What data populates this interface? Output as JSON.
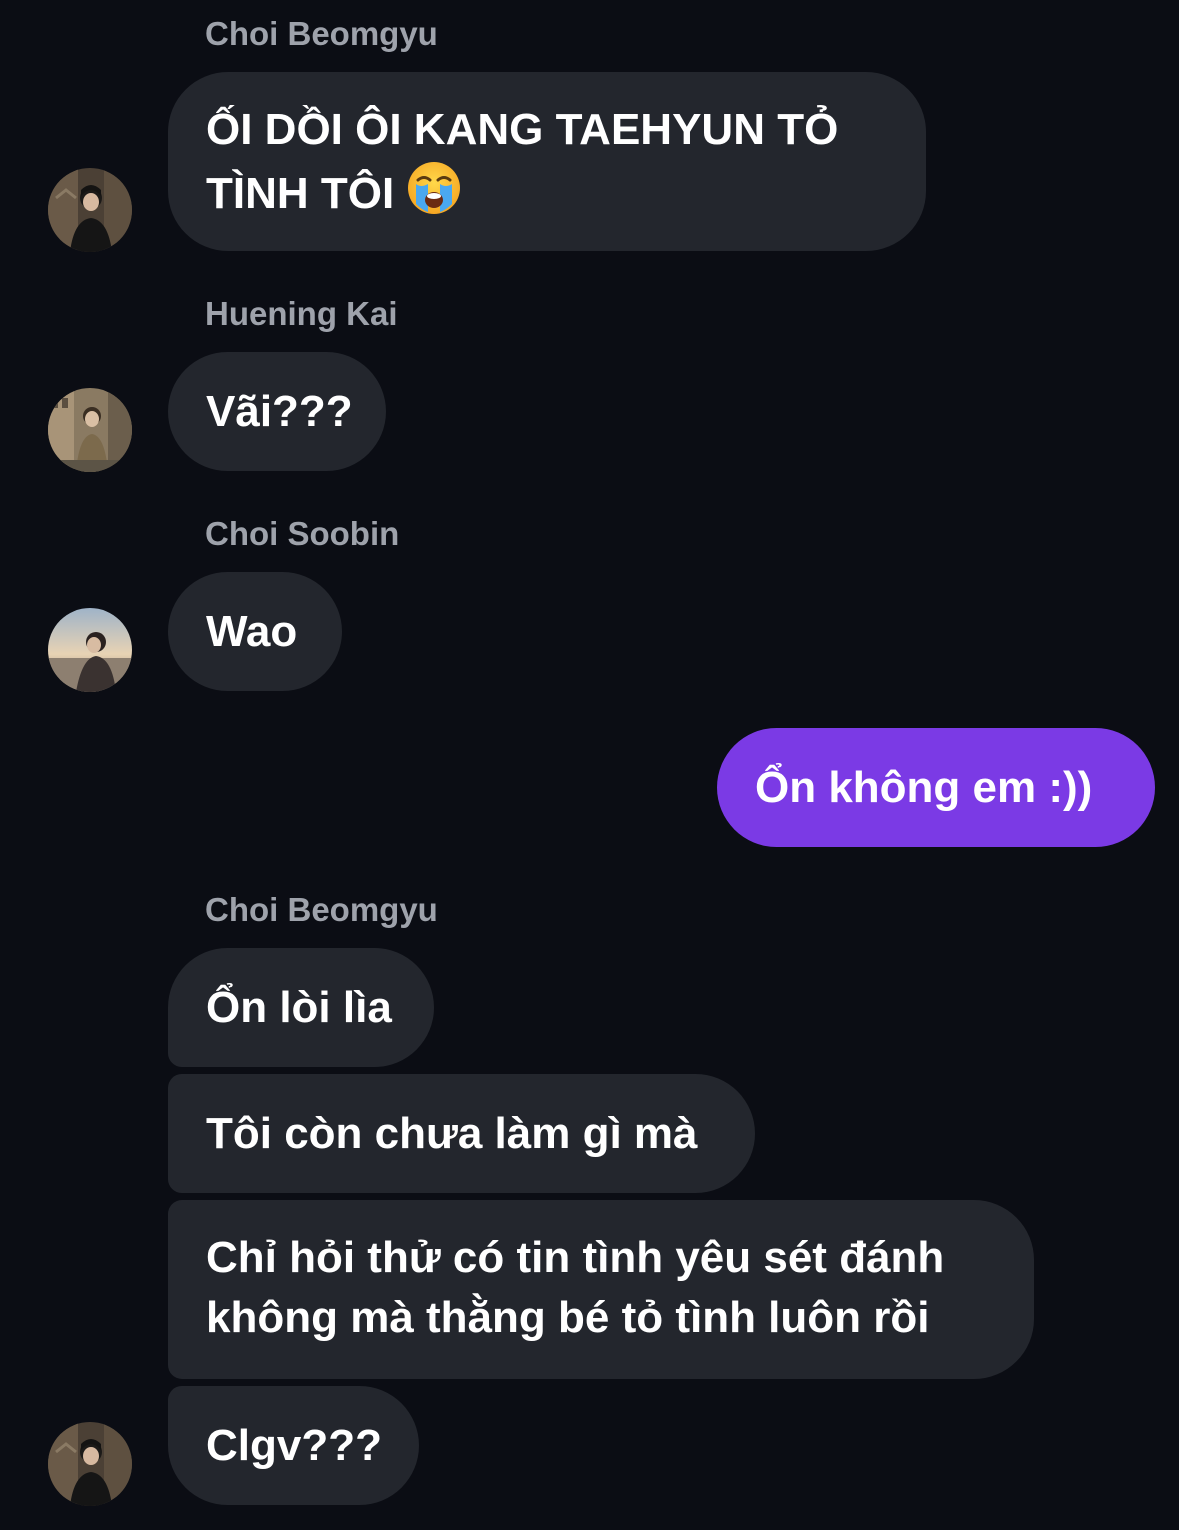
{
  "messages": [
    {
      "sender": "Choi Beomgyu",
      "avatar_icon": "avatar-choi-beomgyu",
      "lines": [
        "ỐI DỒI ÔI KANG TAEHYUN TỎ",
        "TÌNH TÔI"
      ],
      "emoji": "loudly-crying-face-icon"
    },
    {
      "sender": "Huening Kai",
      "avatar_icon": "avatar-huening-kai",
      "lines": [
        "Vãi???"
      ]
    },
    {
      "sender": "Choi Soobin",
      "avatar_icon": "avatar-choi-soobin",
      "lines": [
        "Wao"
      ]
    },
    {
      "outgoing": true,
      "lines": [
        "Ổn không em :))"
      ]
    },
    {
      "sender": "Choi Beomgyu",
      "avatar_icon": "avatar-choi-beomgyu",
      "group": [
        [
          "Ổn lòi lìa"
        ],
        [
          "Tôi còn chưa làm gì mà"
        ],
        [
          "Chỉ hỏi thử có tin tình yêu sét đánh",
          "không mà thằng bé tỏ tình luôn rồi"
        ],
        [
          "Clgv???"
        ]
      ]
    }
  ],
  "colors": {
    "background": "#0b0d14",
    "incoming_bubble": "#23262d",
    "outgoing_bubble": "#7b3ae5",
    "sender_name": "#9ea2ab",
    "text": "#ffffff"
  }
}
